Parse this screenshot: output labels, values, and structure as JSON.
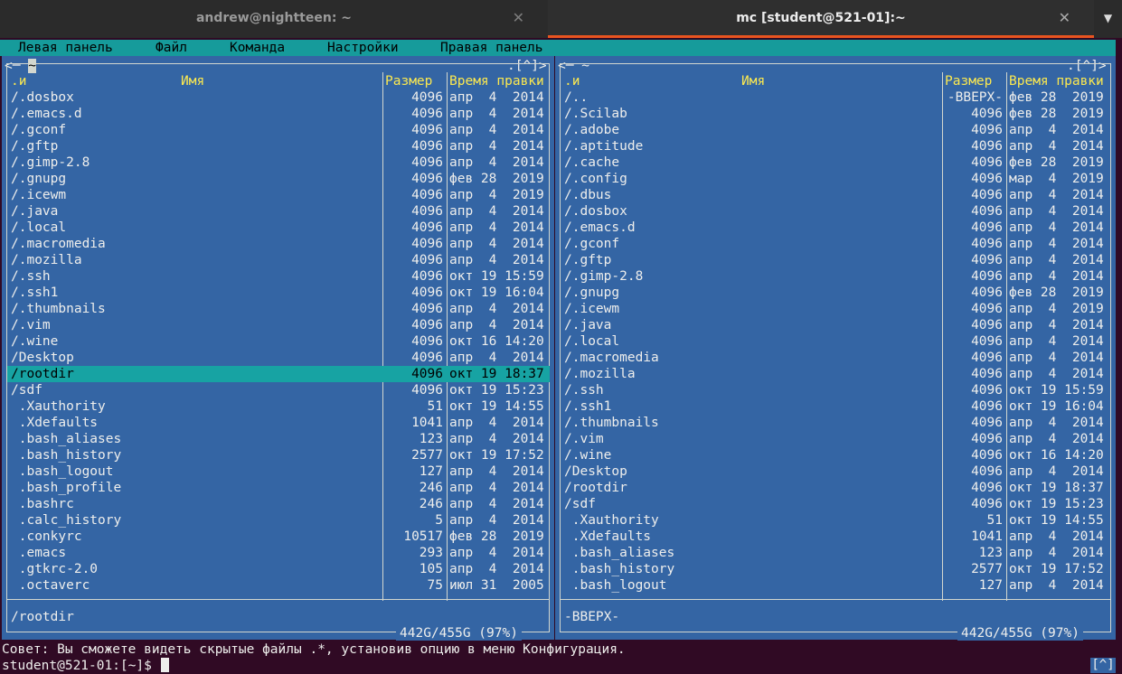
{
  "tabs": [
    {
      "title": "andrew@nightteen: ~",
      "close": "✕"
    },
    {
      "title": "mc [student@521-01]:~",
      "close": "✕"
    }
  ],
  "tab_menu": "▼",
  "menubar": [
    "Левая панель",
    "Файл",
    "Команда",
    "Настройки",
    "Правая панель"
  ],
  "columns": {
    "name": "Имя",
    "sort": ".и",
    "size": "Размер",
    "mtime": "Время правки"
  },
  "left": {
    "hdr_prefix": "<─ ",
    "path": "~",
    "hdr_suffix": ".[^]>",
    "rows": [
      {
        "name": "/.dosbox",
        "size": "4096",
        "date": "апр  4  2014"
      },
      {
        "name": "/.emacs.d",
        "size": "4096",
        "date": "апр  4  2014"
      },
      {
        "name": "/.gconf",
        "size": "4096",
        "date": "апр  4  2014"
      },
      {
        "name": "/.gftp",
        "size": "4096",
        "date": "апр  4  2014"
      },
      {
        "name": "/.gimp-2.8",
        "size": "4096",
        "date": "апр  4  2014"
      },
      {
        "name": "/.gnupg",
        "size": "4096",
        "date": "фев 28  2019"
      },
      {
        "name": "/.icewm",
        "size": "4096",
        "date": "апр  4  2019"
      },
      {
        "name": "/.java",
        "size": "4096",
        "date": "апр  4  2014"
      },
      {
        "name": "/.local",
        "size": "4096",
        "date": "апр  4  2014"
      },
      {
        "name": "/.macromedia",
        "size": "4096",
        "date": "апр  4  2014"
      },
      {
        "name": "/.mozilla",
        "size": "4096",
        "date": "апр  4  2014"
      },
      {
        "name": "/.ssh",
        "size": "4096",
        "date": "окт 19 15:59"
      },
      {
        "name": "/.ssh1",
        "size": "4096",
        "date": "окт 19 16:04"
      },
      {
        "name": "/.thumbnails",
        "size": "4096",
        "date": "апр  4  2014"
      },
      {
        "name": "/.vim",
        "size": "4096",
        "date": "апр  4  2014"
      },
      {
        "name": "/.wine",
        "size": "4096",
        "date": "окт 16 14:20"
      },
      {
        "name": "/Desktop",
        "size": "4096",
        "date": "апр  4  2014"
      },
      {
        "name": "/rootdir",
        "size": "4096",
        "date": "окт 19 18:37"
      },
      {
        "name": "/sdf",
        "size": "4096",
        "date": "окт 19 15:23"
      },
      {
        "name": " .Xauthority",
        "size": "51",
        "date": "окт 19 14:55"
      },
      {
        "name": " .Xdefaults",
        "size": "1041",
        "date": "апр  4  2014"
      },
      {
        "name": " .bash_aliases",
        "size": "123",
        "date": "апр  4  2014"
      },
      {
        "name": " .bash_history",
        "size": "2577",
        "date": "окт 19 17:52"
      },
      {
        "name": " .bash_logout",
        "size": "127",
        "date": "апр  4  2014"
      },
      {
        "name": " .bash_profile",
        "size": "246",
        "date": "апр  4  2014"
      },
      {
        "name": " .bashrc",
        "size": "246",
        "date": "апр  4  2014"
      },
      {
        "name": " .calc_history",
        "size": "5",
        "date": "апр  4  2014"
      },
      {
        "name": " .conkyrc",
        "size": "10517",
        "date": "фев 28  2019"
      },
      {
        "name": " .emacs",
        "size": "293",
        "date": "апр  4  2014"
      },
      {
        "name": " .gtkrc-2.0",
        "size": "105",
        "date": "апр  4  2014"
      },
      {
        "name": " .octaverc",
        "size": "75",
        "date": "июл 31  2005"
      }
    ],
    "selected_row": 17,
    "mini_status": "/rootdir",
    "usage": "442G/455G (97%)"
  },
  "right": {
    "hdr_prefix": "<─ ~",
    "hdr_suffix": ".[^]>",
    "rows": [
      {
        "name": "/..",
        "size": "-ВВЕРХ-",
        "date": "фев 28  2019"
      },
      {
        "name": "/.Scilab",
        "size": "4096",
        "date": "фев 28  2019"
      },
      {
        "name": "/.adobe",
        "size": "4096",
        "date": "апр  4  2014"
      },
      {
        "name": "/.aptitude",
        "size": "4096",
        "date": "апр  4  2014"
      },
      {
        "name": "/.cache",
        "size": "4096",
        "date": "фев 28  2019"
      },
      {
        "name": "/.config",
        "size": "4096",
        "date": "мар  4  2019"
      },
      {
        "name": "/.dbus",
        "size": "4096",
        "date": "апр  4  2014"
      },
      {
        "name": "/.dosbox",
        "size": "4096",
        "date": "апр  4  2014"
      },
      {
        "name": "/.emacs.d",
        "size": "4096",
        "date": "апр  4  2014"
      },
      {
        "name": "/.gconf",
        "size": "4096",
        "date": "апр  4  2014"
      },
      {
        "name": "/.gftp",
        "size": "4096",
        "date": "апр  4  2014"
      },
      {
        "name": "/.gimp-2.8",
        "size": "4096",
        "date": "апр  4  2014"
      },
      {
        "name": "/.gnupg",
        "size": "4096",
        "date": "фев 28  2019"
      },
      {
        "name": "/.icewm",
        "size": "4096",
        "date": "апр  4  2019"
      },
      {
        "name": "/.java",
        "size": "4096",
        "date": "апр  4  2014"
      },
      {
        "name": "/.local",
        "size": "4096",
        "date": "апр  4  2014"
      },
      {
        "name": "/.macromedia",
        "size": "4096",
        "date": "апр  4  2014"
      },
      {
        "name": "/.mozilla",
        "size": "4096",
        "date": "апр  4  2014"
      },
      {
        "name": "/.ssh",
        "size": "4096",
        "date": "окт 19 15:59"
      },
      {
        "name": "/.ssh1",
        "size": "4096",
        "date": "окт 19 16:04"
      },
      {
        "name": "/.thumbnails",
        "size": "4096",
        "date": "апр  4  2014"
      },
      {
        "name": "/.vim",
        "size": "4096",
        "date": "апр  4  2014"
      },
      {
        "name": "/.wine",
        "size": "4096",
        "date": "окт 16 14:20"
      },
      {
        "name": "/Desktop",
        "size": "4096",
        "date": "апр  4  2014"
      },
      {
        "name": "/rootdir",
        "size": "4096",
        "date": "окт 19 18:37"
      },
      {
        "name": "/sdf",
        "size": "4096",
        "date": "окт 19 15:23"
      },
      {
        "name": " .Xauthority",
        "size": "51",
        "date": "окт 19 14:55"
      },
      {
        "name": " .Xdefaults",
        "size": "1041",
        "date": "апр  4  2014"
      },
      {
        "name": " .bash_aliases",
        "size": "123",
        "date": "апр  4  2014"
      },
      {
        "name": " .bash_history",
        "size": "2577",
        "date": "окт 19 17:52"
      },
      {
        "name": " .bash_logout",
        "size": "127",
        "date": "апр  4  2014"
      }
    ],
    "selected_row": -1,
    "mini_status": "-ВВЕРХ-",
    "usage": "442G/455G (97%)"
  },
  "hint": "Совет: Вы сможете видеть скрытые файлы .*, установив опцию в меню Конфигурация.",
  "prompt": "student@521-01:[~]$ ",
  "corner": "[^]",
  "colors": {
    "panel_bg": "#3465a4",
    "selection": "#17a3a3",
    "header_text": "#fce94f",
    "terminal_bg": "#300a24",
    "tab_accent": "#e95420"
  }
}
